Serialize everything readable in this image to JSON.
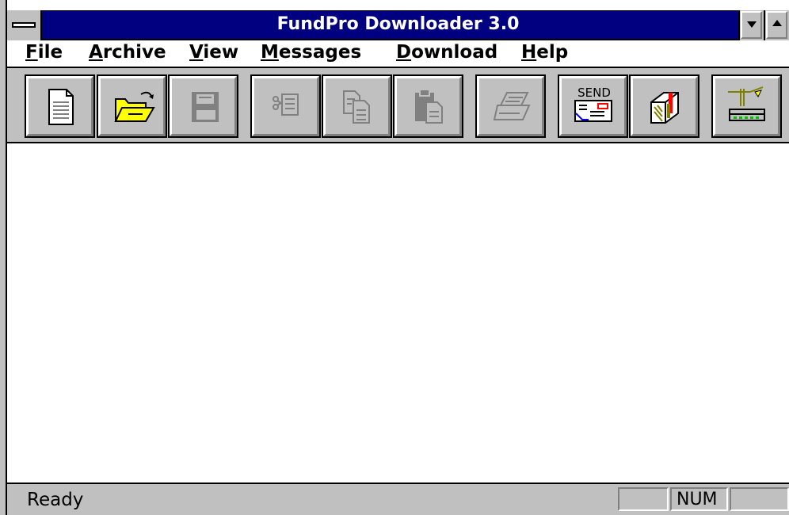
{
  "window": {
    "title": "FundPro Downloader 3.0"
  },
  "menubar": {
    "items": [
      {
        "mnemonic": "F",
        "rest": "ile"
      },
      {
        "mnemonic": "A",
        "rest": "rchive"
      },
      {
        "mnemonic": "V",
        "rest": "iew"
      },
      {
        "mnemonic": "M",
        "rest": "essages"
      },
      {
        "mnemonic": "D",
        "rest": "ownload"
      },
      {
        "mnemonic": "H",
        "rest": "elp"
      }
    ]
  },
  "toolbar": {
    "buttons": [
      {
        "name": "new-document-icon",
        "enabled": true
      },
      {
        "name": "open-folder-icon",
        "enabled": true
      },
      {
        "name": "save-disk-icon",
        "enabled": false
      },
      {
        "name": "cut-icon",
        "enabled": false
      },
      {
        "name": "copy-icon",
        "enabled": false
      },
      {
        "name": "paste-icon",
        "enabled": false
      },
      {
        "name": "print-icon",
        "enabled": false
      },
      {
        "name": "send-envelope-icon",
        "enabled": true,
        "label": "SEND"
      },
      {
        "name": "mailbox-icon",
        "enabled": true
      },
      {
        "name": "modem-icon",
        "enabled": true
      }
    ]
  },
  "statusbar": {
    "text": "Ready",
    "panels": [
      "",
      "NUM",
      ""
    ]
  },
  "colors": {
    "titlebar": "#000080",
    "chrome": "#c0c0c0",
    "client": "#ffffff",
    "folder": "#ffff00",
    "flag": "#ff0000"
  }
}
